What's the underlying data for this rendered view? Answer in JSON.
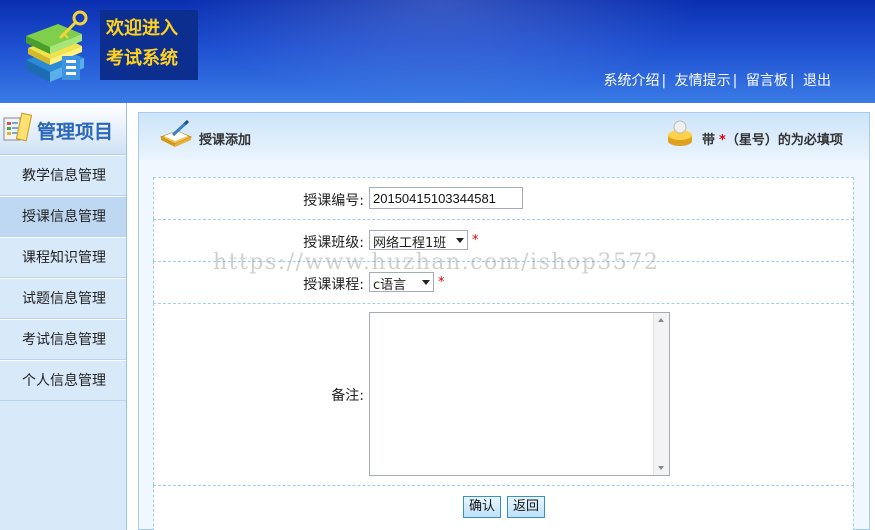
{
  "header": {
    "logo_line1": "欢迎进入",
    "logo_line2": "考试系统",
    "nav": [
      {
        "label": "系统介绍"
      },
      {
        "label": "友情提示"
      },
      {
        "label": "留言板"
      },
      {
        "label": "退出"
      }
    ],
    "separator": "|",
    "logo_icon": "stacked-books-key-icon"
  },
  "sidebar": {
    "title": "管理项目",
    "title_icon": "management-icon",
    "items": [
      {
        "label": "教学信息管理"
      },
      {
        "label": "授课信息管理",
        "active": true
      },
      {
        "label": "课程知识管理"
      },
      {
        "label": "试题信息管理"
      },
      {
        "label": "考试信息管理"
      },
      {
        "label": "个人信息管理"
      }
    ]
  },
  "panel": {
    "title": "授课添加",
    "title_icon": "book-pen-icon",
    "required_note_prefix": "带",
    "required_star": "*",
    "required_note_suffix": "（星号）的为必填项",
    "required_icon": "coin-stack-icon"
  },
  "form": {
    "code_label": "授课编号:",
    "code_value": "20150415103344581",
    "class_label": "授课班级:",
    "class_value": "网络工程1班",
    "course_label": "授课课程:",
    "course_value": "c语言",
    "remark_label": "备注:",
    "remark_value": "",
    "star": "*",
    "confirm_label": "确认",
    "back_label": "返回"
  },
  "watermark": "https://www.huzhan.com/ishop3572",
  "colors": {
    "header_top": "#0a2fb0",
    "header_bottom": "#3a7be6",
    "logo_text": "#ffd21f",
    "sidebar_bg": "#d8e9fa",
    "sidebar_title": "#2a67b8",
    "required_star": "#e00000",
    "row_border": "#9fd0ea"
  }
}
